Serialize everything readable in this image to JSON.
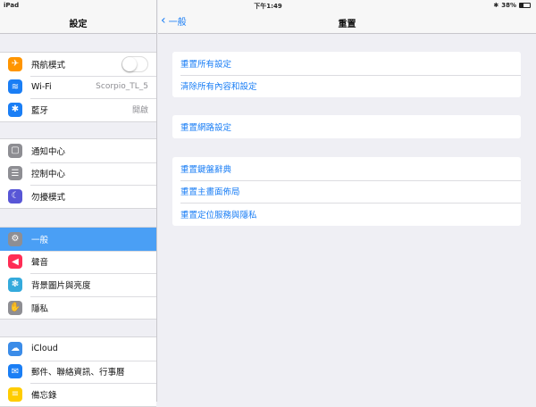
{
  "status": {
    "device": "iPad",
    "time": "下午1:49",
    "battery": "38%",
    "battery_level": 0.38
  },
  "sidebar": {
    "title": "設定",
    "groups": [
      [
        {
          "label": "飛航模式",
          "icon": "airplane-icon",
          "color": "#ff9500",
          "toggle": false
        },
        {
          "label": "Wi-Fi",
          "icon": "wifi-icon",
          "color": "#1a7ef5",
          "value": "Scorpio_TL_5"
        },
        {
          "label": "藍牙",
          "icon": "bluetooth-icon",
          "color": "#1a7ef5",
          "value": "開啟"
        }
      ],
      [
        {
          "label": "通知中心",
          "icon": "notification-center-icon",
          "color": "#8e8e93"
        },
        {
          "label": "控制中心",
          "icon": "control-center-icon",
          "color": "#8e8e93"
        },
        {
          "label": "勿擾模式",
          "icon": "moon-icon",
          "color": "#5856d6"
        }
      ],
      [
        {
          "label": "一般",
          "icon": "gear-icon",
          "color": "#8e8e93",
          "selected": true
        },
        {
          "label": "聲音",
          "icon": "speaker-icon",
          "color": "#ff2d55"
        },
        {
          "label": "背景圖片與亮度",
          "icon": "wallpaper-icon",
          "color": "#34aadc"
        },
        {
          "label": "隱私",
          "icon": "hand-icon",
          "color": "#8e8e93"
        }
      ],
      [
        {
          "label": "iCloud",
          "icon": "cloud-icon",
          "color": "#3b8ce8"
        },
        {
          "label": "郵件、聯絡資訊、行事曆",
          "icon": "mail-icon",
          "color": "#1a7ef5"
        },
        {
          "label": "備忘錄",
          "icon": "notes-icon",
          "color": "#ffcc00"
        }
      ]
    ]
  },
  "detail": {
    "back_label": "一般",
    "title": "重置",
    "groups": [
      [
        "重置所有設定",
        "清除所有內容和設定"
      ],
      [
        "重置網路設定"
      ],
      [
        "重置鍵盤辭典",
        "重置主畫面佈局",
        "重置定位服務與隱私"
      ]
    ]
  }
}
